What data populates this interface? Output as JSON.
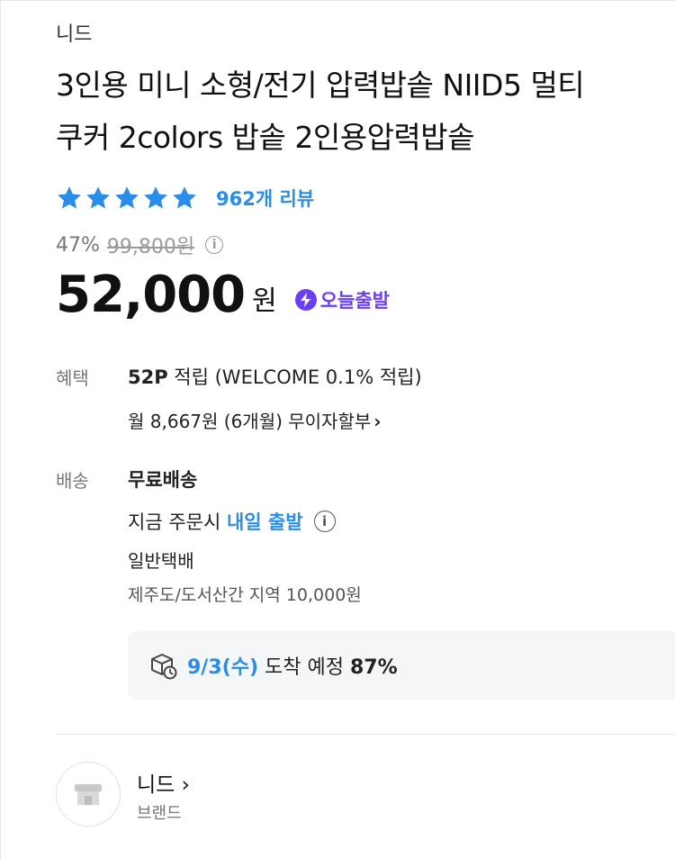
{
  "brand": "니드",
  "product": {
    "title_line1": "3인용 미니 소형/전기 압력밥솥 NIID5 멀티",
    "title_line2": "쿠커 2colors 밥솥 2인용압력밥솥"
  },
  "rating": {
    "stars": 5,
    "review_count_label": "962개 리뷰"
  },
  "pricing": {
    "discount": "47%",
    "original_price": "99,800원",
    "price": "52,000",
    "currency": "원",
    "badge_label": "오늘출발",
    "info_glyph": "i"
  },
  "benefit": {
    "label": "혜택",
    "points_bold": "52P",
    "points_rest": " 적립 (WELCOME 0.1% 적립)",
    "installment": "월 8,667원 (6개월) 무이자할부",
    "installment_chevron": "›"
  },
  "shipping": {
    "label": "배송",
    "fee": "무료배송",
    "order_prefix": "지금 주문시 ",
    "order_highlight": "내일 출발",
    "carrier": "일반택배",
    "jeju_note": "제주도/도서산간 지역 10,000원"
  },
  "eta": {
    "date": "9/3(수)",
    "middle": " 도착 예정 ",
    "percent": "87%"
  },
  "store": {
    "name": "니드 ›",
    "sub": "브랜드"
  },
  "colors": {
    "accent_blue": "#2a8de9",
    "badge_purple": "#6b3ff5"
  },
  "icons": {
    "star": "star-icon",
    "info": "info-icon",
    "bolt": "lightning-icon",
    "box": "delivery-box-icon",
    "store": "store-icon"
  }
}
